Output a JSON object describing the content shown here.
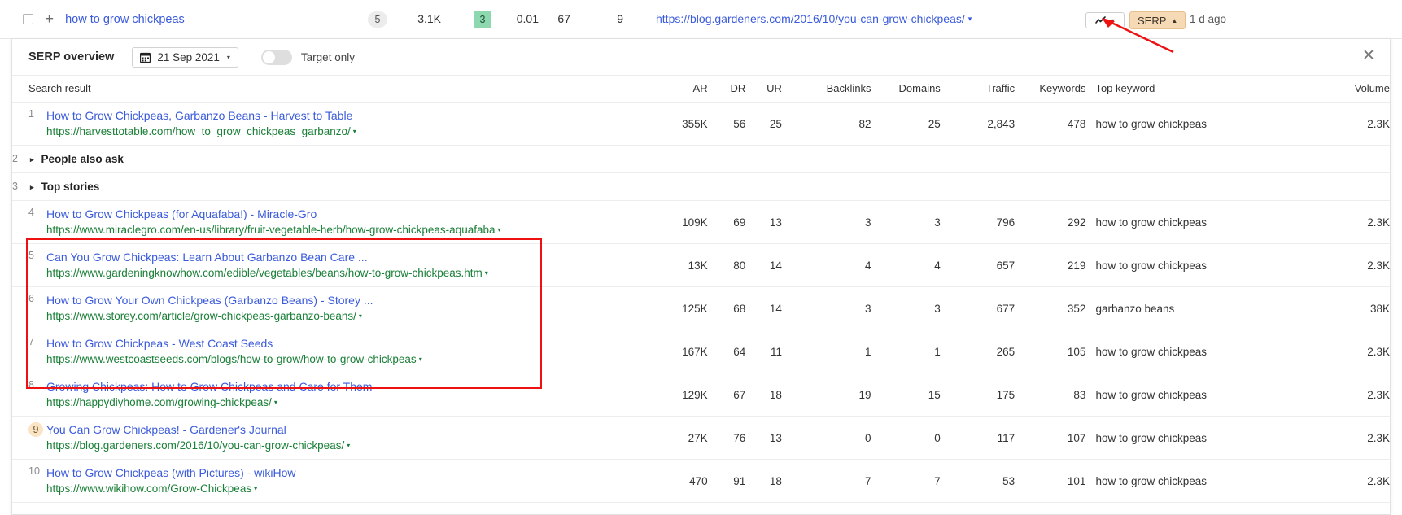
{
  "keyword_row": {
    "keyword": "how to grow chickpeas",
    "sf": "5",
    "volume": "3.1K",
    "kd": "3",
    "cpc": "0.01",
    "traffic": "67",
    "paid": "9",
    "url": "https://blog.gardeners.com/2016/10/you-can-grow-chickpeas/",
    "caret": "▾",
    "chart_caret": "▾",
    "serp_label": "SERP",
    "serp_caret": "▲",
    "updated": "1 d ago"
  },
  "panel": {
    "title": "SERP overview",
    "date": "21 Sep 2021",
    "date_caret": "▾",
    "toggle_label": "Target only",
    "close": "✕"
  },
  "table": {
    "headers": {
      "result": "Search result",
      "ar": "AR",
      "dr": "DR",
      "ur": "UR",
      "backlinks": "Backlinks",
      "domains": "Domains",
      "traffic": "Traffic",
      "keywords": "Keywords",
      "top_keyword": "Top keyword",
      "volume": "Volume"
    },
    "rows": [
      {
        "rank": "1",
        "type": "result",
        "title": "How to Grow Chickpeas, Garbanzo Beans - Harvest to Table",
        "url": "https://harvesttotable.com/how_to_grow_chickpeas_garbanzo/",
        "caret": "▾",
        "ar": "355K",
        "dr": "56",
        "ur": "25",
        "backlinks": "82",
        "domains": "25",
        "traffic": "2,843",
        "keywords": "478",
        "top_keyword": "how to grow chickpeas",
        "volume": "2.3K"
      },
      {
        "rank": "2",
        "type": "feature",
        "title": "People also ask",
        "tri": "▸"
      },
      {
        "rank": "3",
        "type": "feature",
        "title": "Top stories",
        "tri": "▸"
      },
      {
        "rank": "4",
        "type": "result",
        "title": "How to Grow Chickpeas (for Aquafaba!) - Miracle-Gro",
        "url": "https://www.miraclegro.com/en-us/library/fruit-vegetable-herb/how-grow-chickpeas-aquafaba",
        "caret": "▾",
        "ar": "109K",
        "dr": "69",
        "ur": "13",
        "backlinks": "3",
        "domains": "3",
        "traffic": "796",
        "keywords": "292",
        "top_keyword": "how to grow chickpeas",
        "volume": "2.3K"
      },
      {
        "rank": "5",
        "type": "result",
        "title": "Can You Grow Chickpeas: Learn About Garbanzo Bean Care ...",
        "url": "https://www.gardeningknowhow.com/edible/vegetables/beans/how-to-grow-chickpeas.htm",
        "caret": "▾",
        "ar": "13K",
        "dr": "80",
        "ur": "14",
        "backlinks": "4",
        "domains": "4",
        "traffic": "657",
        "keywords": "219",
        "top_keyword": "how to grow chickpeas",
        "volume": "2.3K"
      },
      {
        "rank": "6",
        "type": "result",
        "title": "How to Grow Your Own Chickpeas (Garbanzo Beans) - Storey ...",
        "url": "https://www.storey.com/article/grow-chickpeas-garbanzo-beans/",
        "caret": "▾",
        "ar": "125K",
        "dr": "68",
        "ur": "14",
        "backlinks": "3",
        "domains": "3",
        "traffic": "677",
        "keywords": "352",
        "top_keyword": "garbanzo beans",
        "volume": "38K"
      },
      {
        "rank": "7",
        "type": "result",
        "title": "How to Grow Chickpeas - West Coast Seeds",
        "url": "https://www.westcoastseeds.com/blogs/how-to-grow/how-to-grow-chickpeas",
        "caret": "▾",
        "ar": "167K",
        "dr": "64",
        "ur": "11",
        "backlinks": "1",
        "domains": "1",
        "traffic": "265",
        "keywords": "105",
        "top_keyword": "how to grow chickpeas",
        "volume": "2.3K"
      },
      {
        "rank": "8",
        "type": "result",
        "title": "Growing Chickpeas: How to Grow Chickpeas and Care for Them",
        "url": "https://happydiyhome.com/growing-chickpeas/",
        "caret": "▾",
        "ar": "129K",
        "dr": "67",
        "ur": "18",
        "backlinks": "19",
        "domains": "15",
        "traffic": "175",
        "keywords": "83",
        "top_keyword": "how to grow chickpeas",
        "volume": "2.3K"
      },
      {
        "rank": "9",
        "type": "result",
        "highlighted": true,
        "title": "You Can Grow Chickpeas! - Gardener's Journal",
        "url": "https://blog.gardeners.com/2016/10/you-can-grow-chickpeas/",
        "caret": "▾",
        "ar": "27K",
        "dr": "76",
        "ur": "13",
        "backlinks": "0",
        "domains": "0",
        "traffic": "117",
        "keywords": "107",
        "top_keyword": "how to grow chickpeas",
        "volume": "2.3K"
      },
      {
        "rank": "10",
        "type": "result",
        "title": "How to Grow Chickpeas (with Pictures) - wikiHow",
        "url": "https://www.wikihow.com/Grow-Chickpeas",
        "caret": "▾",
        "ar": "470",
        "dr": "91",
        "ur": "18",
        "backlinks": "7",
        "domains": "7",
        "traffic": "53",
        "keywords": "101",
        "top_keyword": "how to grow chickpeas",
        "volume": "2.3K"
      }
    ]
  },
  "colors": {
    "link": "#3b5bdb",
    "url_green": "#1a7f37",
    "kd_green": "#8ed8b0",
    "serp_amber": "#f6d9b5",
    "annotation_red": "#ee1111"
  }
}
